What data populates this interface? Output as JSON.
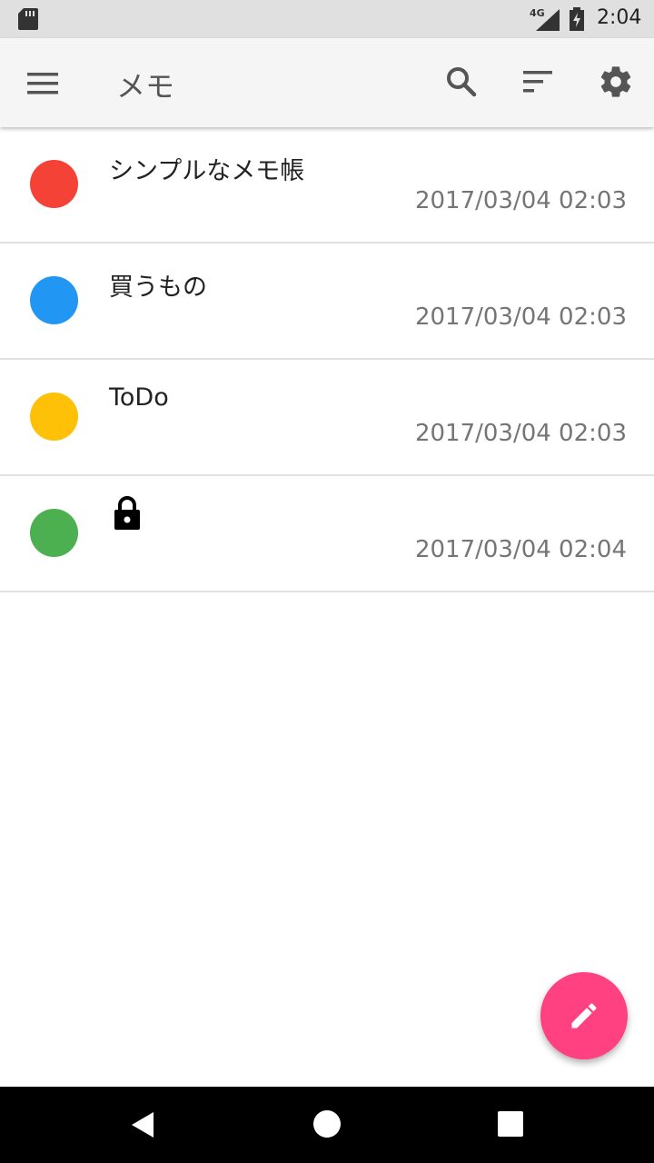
{
  "status_bar": {
    "network": "4G",
    "time": "2:04"
  },
  "app_bar": {
    "title": "メモ"
  },
  "memos": [
    {
      "title": "シンプルなメモ帳",
      "date": "2017/03/04 02:03",
      "color": "#f44336",
      "locked": false
    },
    {
      "title": "買うもの",
      "date": "2017/03/04 02:03",
      "color": "#2196f3",
      "locked": false
    },
    {
      "title": "ToDo",
      "date": "2017/03/04 02:03",
      "color": "#ffc107",
      "locked": false
    },
    {
      "title": "",
      "date": "2017/03/04 02:04",
      "color": "#4caf50",
      "locked": true
    }
  ],
  "colors": {
    "fab": "#ff4081",
    "app_bar": "#f5f5f5",
    "status_bar": "#e0e0e0"
  }
}
